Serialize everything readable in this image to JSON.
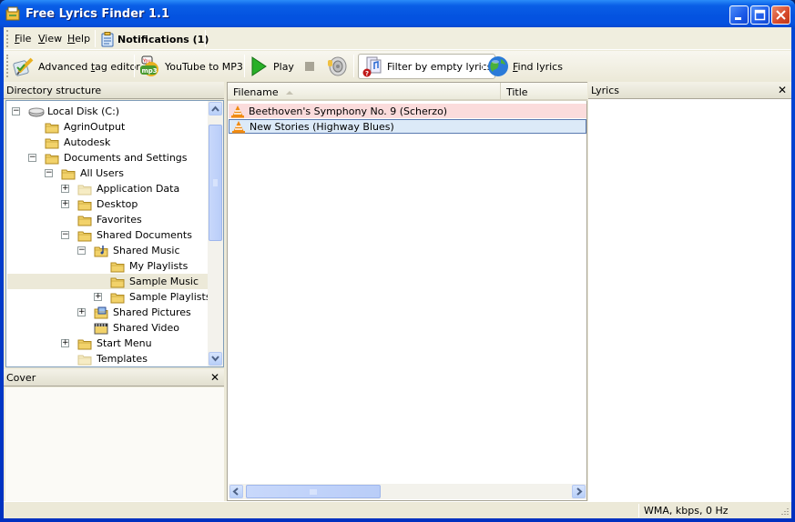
{
  "window": {
    "title": "Free Lyrics Finder 1.1",
    "controls": [
      "minimize",
      "maximize",
      "close"
    ]
  },
  "menubar": {
    "items": [
      {
        "label": "File",
        "accel": "F",
        "rest": "ile"
      },
      {
        "label": "View",
        "accel": "V",
        "rest": "iew"
      },
      {
        "label": "Help",
        "accel": "H",
        "rest": "elp"
      }
    ],
    "notifications_label": "Notifications (1)"
  },
  "toolbar": {
    "advanced_tag_editor": {
      "pre": "Advanced ",
      "accel": "t",
      "post": "ag editor",
      "icon": "tag-editor-icon"
    },
    "youtube_to_mp3": {
      "label": "YouTube to MP3",
      "icon": "youtube-mp3-icon"
    },
    "play": {
      "label": "Play",
      "icon": "play-icon"
    },
    "stop": {
      "icon": "stop-icon"
    },
    "volume": {
      "icon": "speaker-icon"
    },
    "filter": {
      "label": "Filter by empty lyrics",
      "icon": "filter-lyrics-icon",
      "active": true
    },
    "find_lyrics": {
      "accel": "F",
      "rest": "ind lyrics",
      "icon": "globe-icon"
    }
  },
  "directory": {
    "title": "Directory structure",
    "items": [
      {
        "label": "Local Disk (C:)",
        "level": 0,
        "expander": "minus",
        "icon": "drive"
      },
      {
        "label": "AgrinOutput",
        "level": 1,
        "expander": "",
        "icon": "folder"
      },
      {
        "label": "Autodesk",
        "level": 1,
        "expander": "",
        "icon": "folder"
      },
      {
        "label": "Documents and Settings",
        "level": 1,
        "expander": "minus",
        "icon": "folder-open"
      },
      {
        "label": "All Users",
        "level": 2,
        "expander": "minus",
        "icon": "folder-open"
      },
      {
        "label": "Application Data",
        "level": 3,
        "expander": "plus",
        "icon": "folder-faded"
      },
      {
        "label": "Desktop",
        "level": 3,
        "expander": "plus",
        "icon": "folder"
      },
      {
        "label": "Favorites",
        "level": 3,
        "expander": "",
        "icon": "folder"
      },
      {
        "label": "Shared Documents",
        "level": 3,
        "expander": "minus",
        "icon": "folder-open"
      },
      {
        "label": "Shared Music",
        "level": 4,
        "expander": "minus",
        "icon": "folder-music"
      },
      {
        "label": "My Playlists",
        "level": 5,
        "expander": "",
        "icon": "folder"
      },
      {
        "label": "Sample Music",
        "level": 5,
        "expander": "",
        "icon": "folder",
        "selected": true
      },
      {
        "label": "Sample Playlists",
        "level": 5,
        "expander": "plus",
        "icon": "folder"
      },
      {
        "label": "Shared Pictures",
        "level": 4,
        "expander": "plus",
        "icon": "folder-pictures"
      },
      {
        "label": "Shared Video",
        "level": 4,
        "expander": "",
        "icon": "folder-video"
      },
      {
        "label": "Start Menu",
        "level": 3,
        "expander": "plus",
        "icon": "folder"
      },
      {
        "label": "Templates",
        "level": 3,
        "expander": "",
        "icon": "folder-faded"
      }
    ]
  },
  "cover": {
    "title": "Cover"
  },
  "filelist": {
    "columns": [
      "Filename",
      "Title"
    ],
    "rows": [
      {
        "filename": "Beethoven's Symphony No. 9 (Scherzo)",
        "highlight": "#fbdcdc"
      },
      {
        "filename": "New Stories (Highway Blues)",
        "highlight": "#dceaf8"
      }
    ]
  },
  "lyrics": {
    "title": "Lyrics"
  },
  "statusbar": {
    "info": "WMA,  kbps, 0 Hz"
  }
}
